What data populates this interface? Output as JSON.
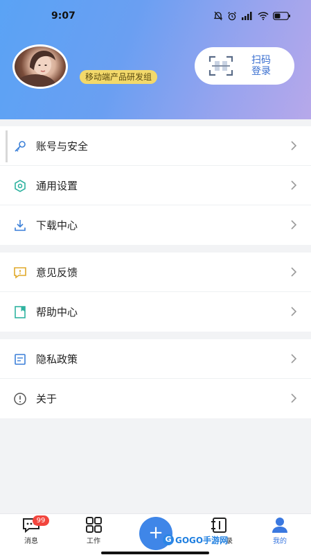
{
  "status_bar": {
    "time": "9:07",
    "icons": [
      "alarm-off-icon",
      "alarm-clock-icon",
      "cellular-signal-icon",
      "wifi-icon",
      "battery-icon"
    ]
  },
  "profile": {
    "group_name": "移动端产品研发组",
    "scan_label": "扫码登录"
  },
  "menu_groups": [
    {
      "items": [
        {
          "label": "账号与安全",
          "icon": "key-icon"
        },
        {
          "label": "通用设置",
          "icon": "settings-hexagon-icon"
        },
        {
          "label": "下载中心",
          "icon": "download-icon"
        }
      ]
    },
    {
      "items": [
        {
          "label": "意见反馈",
          "icon": "feedback-icon"
        },
        {
          "label": "帮助中心",
          "icon": "help-book-icon"
        }
      ]
    },
    {
      "items": [
        {
          "label": "隐私政策",
          "icon": "document-icon"
        },
        {
          "label": "关于",
          "icon": "info-icon"
        }
      ]
    }
  ],
  "tabbar": {
    "messages": {
      "label": "消息",
      "badge": "99"
    },
    "work": {
      "label": "工作"
    },
    "add": {
      "symbol": "+"
    },
    "contacts": {
      "label": "录"
    },
    "mine": {
      "label": "我的"
    }
  },
  "watermark": {
    "text": "GOGO手游网"
  },
  "colors": {
    "accent": "#3f86e8",
    "badge": "#f2453d",
    "group_badge_bg": "#f3d96b"
  }
}
